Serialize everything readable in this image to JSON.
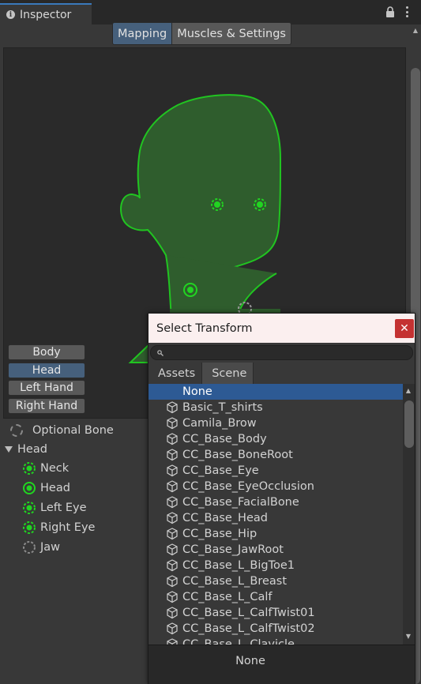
{
  "tab": {
    "title": "Inspector",
    "info_icon": "info-icon",
    "lock_icon": "lock-icon",
    "menu_icon": "kebab-icon"
  },
  "modes": {
    "mapping": "Mapping",
    "muscles": "Muscles & Settings"
  },
  "body_parts": [
    "Body",
    "Head",
    "Left Hand",
    "Right Hand"
  ],
  "tree": {
    "optional": "Optional Bone",
    "group": "Head",
    "bones": [
      {
        "label": "Neck",
        "state": "dashed-green"
      },
      {
        "label": "Head",
        "state": "solid-green"
      },
      {
        "label": "Left Eye",
        "state": "dashed-green"
      },
      {
        "label": "Right Eye",
        "state": "dashed-green"
      },
      {
        "label": "Jaw",
        "state": "dashed-gray"
      }
    ]
  },
  "dialog": {
    "title": "Select Transform",
    "close": "✕",
    "search_placeholder": "",
    "tabs": [
      "Assets",
      "Scene"
    ],
    "items": [
      "None",
      "Basic_T_shirts",
      "Camila_Brow",
      "CC_Base_Body",
      "CC_Base_BoneRoot",
      "CC_Base_Eye",
      "CC_Base_EyeOcclusion",
      "CC_Base_FacialBone",
      "CC_Base_Head",
      "CC_Base_Hip",
      "CC_Base_JawRoot",
      "CC_Base_L_BigToe1",
      "CC_Base_L_Breast",
      "CC_Base_L_Calf",
      "CC_Base_L_CalfTwist01",
      "CC_Base_L_CalfTwist02",
      "CC_Base_L_Clavicle"
    ],
    "selected": "None",
    "footer": "None"
  },
  "colors": {
    "accent": "#46607c",
    "head_fill": "#2f5d2d",
    "head_stroke": "#21c421",
    "selected": "#2d5a94"
  }
}
